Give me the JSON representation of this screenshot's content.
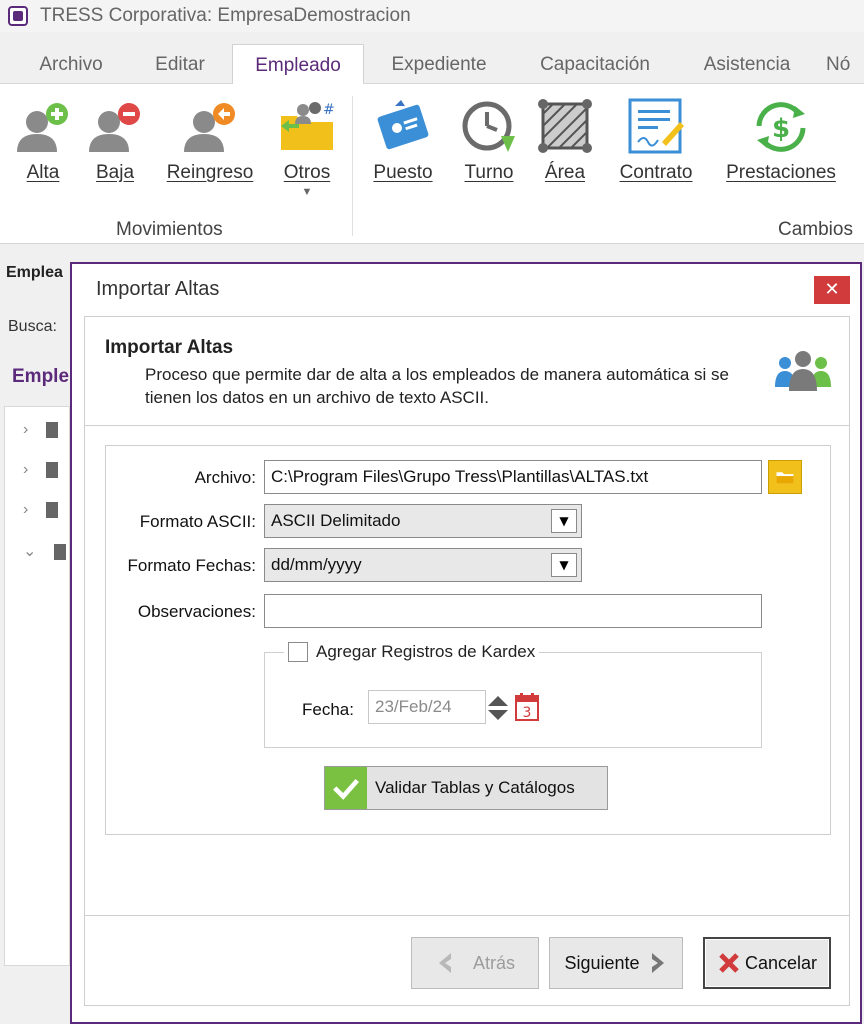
{
  "window": {
    "title": "TRESS Corporativa: EmpresaDemostracion"
  },
  "tabs": [
    {
      "label": "Archivo"
    },
    {
      "label": "Editar"
    },
    {
      "label": "Empleado",
      "active": true
    },
    {
      "label": "Expediente"
    },
    {
      "label": "Capacitación"
    },
    {
      "label": "Asistencia"
    },
    {
      "label": "Nó"
    }
  ],
  "ribbon": {
    "movimientos": {
      "label": "Movimientos",
      "buttons": [
        {
          "label": "Alta",
          "icon": "person-add-icon"
        },
        {
          "label": "Baja",
          "icon": "person-remove-icon"
        },
        {
          "label": "Reingreso",
          "icon": "person-return-icon"
        },
        {
          "label": "Otros",
          "icon": "folder-people-icon"
        }
      ]
    },
    "cambios": {
      "label": "Cambios",
      "buttons": [
        {
          "label": "Puesto",
          "icon": "id-card-icon"
        },
        {
          "label": "Turno",
          "icon": "clock-icon"
        },
        {
          "label": "Área",
          "icon": "area-icon"
        },
        {
          "label": "Contrato",
          "icon": "contract-icon"
        },
        {
          "label": "Prestaciones",
          "icon": "money-cycle-icon"
        }
      ]
    }
  },
  "background": {
    "empleado_label": "Emplea",
    "busca_label": "Busca:",
    "section_label": "Emple"
  },
  "dialog": {
    "title": "Importar Altas",
    "close_label": "✕",
    "header_title": "Importar Altas",
    "header_desc": "Proceso que permite dar de alta a los empleados de manera automática si se tienen los datos en un archivo de texto ASCII.",
    "form": {
      "archivo_label": "Archivo:",
      "archivo_value": "C:\\Program Files\\Grupo Tress\\Plantillas\\ALTAS.txt",
      "formato_ascii_label": "Formato ASCII:",
      "formato_ascii_value": "ASCII Delimitado",
      "formato_fechas_label": "Formato Fechas:",
      "formato_fechas_value": "dd/mm/yyyy",
      "observaciones_label": "Observaciones:",
      "observaciones_value": "",
      "kardex_label": "Agregar Registros de Kardex",
      "kardex_checked": false,
      "fecha_label": "Fecha:",
      "fecha_value": "23/Feb/24",
      "calendar_day": "3",
      "validate_label": "Validar Tablas y Catálogos"
    },
    "footer": {
      "back_label": "Atrás",
      "next_label": "Siguiente",
      "cancel_label": "Cancelar"
    }
  }
}
